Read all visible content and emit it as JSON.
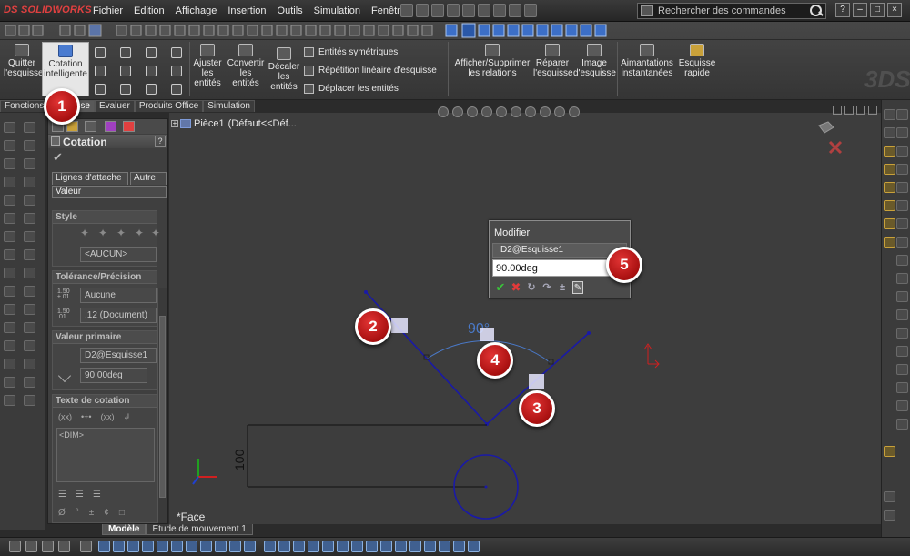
{
  "app": {
    "logo_prefix": "DS",
    "logo_name": "SOLIDWORKS",
    "menu": [
      "Fichier",
      "Edition",
      "Affichage",
      "Insertion",
      "Outils",
      "Simulation",
      "Fenêtre",
      "?"
    ],
    "search_placeholder": "Rechercher des commandes"
  },
  "ribbon": {
    "quit_sketch": "Quitter l'esquisse",
    "smart_dimension": "Cotation intelligente",
    "trim": "Ajuster les entités",
    "convert": "Convertir les entités",
    "offset": "Décaler les entités",
    "mirror": "Entités symétriques",
    "linear_pattern": "Répétition linéaire d'esquisse",
    "move": "Déplacer les entités",
    "relations": "Afficher/Supprimer les relations",
    "repair": "Réparer l'esquisse",
    "sketch_picture": "Image d'esquisse",
    "snaps": "Aimantations instantanées",
    "quick_sketch": "Esquisse rapide"
  },
  "tabs": [
    "Fonctions",
    "Esquisse",
    "Evaluer",
    "Produits Office",
    "Simulation"
  ],
  "active_tab": "Esquisse",
  "property_manager": {
    "title": "Cotation",
    "help": "?",
    "subtabs": [
      "Lignes d'attache",
      "Autre"
    ],
    "active_subtab": "Valeur",
    "style": {
      "label": "Style",
      "value": "<AUCUN>"
    },
    "tolerance": {
      "label": "Tolérance/Précision",
      "tol_value": "Aucune",
      "precision_value": ".12 (Document)",
      "icon_tol": "1.50 ±.01",
      "icon_prec": "1.50 .01"
    },
    "primary_value": {
      "label": "Valeur primaire",
      "name": "D2@Esquisse1",
      "value": "90.00deg"
    },
    "dim_text": {
      "label": "Texte de cotation",
      "placeholder": "<DIM>"
    }
  },
  "tree": {
    "part": "Pièce1",
    "config": "(Défaut<<Déf..."
  },
  "modifier": {
    "title": "Modifier",
    "dim_name": "D2@Esquisse1",
    "value": "90.00deg"
  },
  "sketch": {
    "angle_label": "90°",
    "linear_label": "100",
    "face_label": "*Face"
  },
  "bottom_tabs": [
    "Modèle",
    "Etude de mouvement 1"
  ],
  "active_bottom_tab": "Modèle",
  "markers": [
    "1",
    "2",
    "3",
    "4",
    "5"
  ],
  "colors": {
    "sketch_line": "#1a1aa6",
    "marker_red": "#c41a1a",
    "dimension_blue": "#4a79c8"
  }
}
